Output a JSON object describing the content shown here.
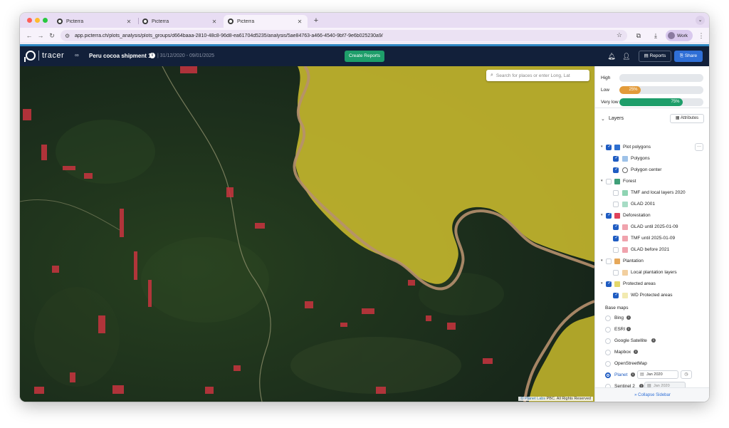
{
  "browser": {
    "tabs": [
      {
        "title": "Picterra",
        "active": false
      },
      {
        "title": "Picterra",
        "active": false
      },
      {
        "title": "Picterra",
        "active": true
      }
    ],
    "new_tab": "+",
    "url": "app.picterra.ch/plots_analysis/plots_groups/d664baaa-2810-48c8-96d8-ea61704d5235/analysis/5ae84763-a466-4540-9bf7-9e6b025230a9/",
    "profile_label": "Work"
  },
  "app": {
    "logo_text": "tracer",
    "project_title": "Peru cocoa shipment 1",
    "project_dates": "| 31/12/2020 - 09/01/2025",
    "create_reports": "Create Reports",
    "reports": "Reports",
    "share": "Share"
  },
  "map": {
    "search_placeholder": "Search for places or enter Long, Lat",
    "attribution_link": "© Planet Labs",
    "attribution_rest": " PBC. All Rights Reserved"
  },
  "risk": [
    {
      "label": "High",
      "value": 0,
      "text": "",
      "color": "#e4e7eb"
    },
    {
      "label": "Low",
      "value": 25,
      "text": "25%",
      "color": "#e39b3a"
    },
    {
      "label": "Very low",
      "value": 75,
      "text": "75%",
      "color": "#1e9e6a"
    }
  ],
  "layers": {
    "title": "Layers",
    "attributes_button": "Attributes",
    "groups": [
      {
        "label": "Plot polygons",
        "checked": true,
        "swatch": "#2e6fd0",
        "children": [
          {
            "label": "Polygons",
            "checked": true,
            "swatch": "#9ec2e8"
          },
          {
            "label": "Polygon center",
            "checked": true,
            "swatch": "circle"
          }
        ]
      },
      {
        "label": "Forest",
        "checked": false,
        "swatch": "#3f9f78",
        "children": [
          {
            "label": "TMF and local layers 2020",
            "checked": false,
            "swatch": "#8fd4b3"
          },
          {
            "label": "GLAD 2001",
            "checked": false,
            "swatch": "#a7dcc5"
          }
        ]
      },
      {
        "label": "Deforestation",
        "checked": true,
        "swatch": "#e0425a",
        "children": [
          {
            "label": "GLAD until 2025-01-09",
            "checked": true,
            "swatch": "#f0a3ad"
          },
          {
            "label": "TMF until 2025-01-09",
            "checked": true,
            "swatch": "#f0a3ad"
          },
          {
            "label": "GLAD before 2021",
            "checked": false,
            "swatch": "#f0a3ad"
          }
        ]
      },
      {
        "label": "Plantation",
        "checked": false,
        "swatch": "#e6a85a",
        "children": [
          {
            "label": "Local plantation layers",
            "checked": false,
            "swatch": "#f2cf9f"
          }
        ]
      },
      {
        "label": "Protected areas",
        "checked": true,
        "swatch": "#e4d86a",
        "children": [
          {
            "label": "WD Protected areas",
            "checked": true,
            "swatch": "#f2eab0"
          }
        ]
      }
    ]
  },
  "basemaps": {
    "title": "Base maps",
    "items": [
      {
        "label": "Bing",
        "selected": false,
        "info": true
      },
      {
        "label": "ESRI",
        "selected": false,
        "info": true
      },
      {
        "label": "Google Satellite",
        "selected": false,
        "info": true
      },
      {
        "label": "Mapbox",
        "selected": false,
        "info": true
      },
      {
        "label": "OpenStreetMap",
        "selected": false,
        "info": false
      },
      {
        "label": "Planet",
        "selected": true,
        "info": true,
        "date": "Jan 2020"
      },
      {
        "label": "Sentinel 2",
        "selected": false,
        "info": true,
        "date": "Jan 2020"
      }
    ]
  },
  "collapse_sidebar": "Collapse Sidebar"
}
